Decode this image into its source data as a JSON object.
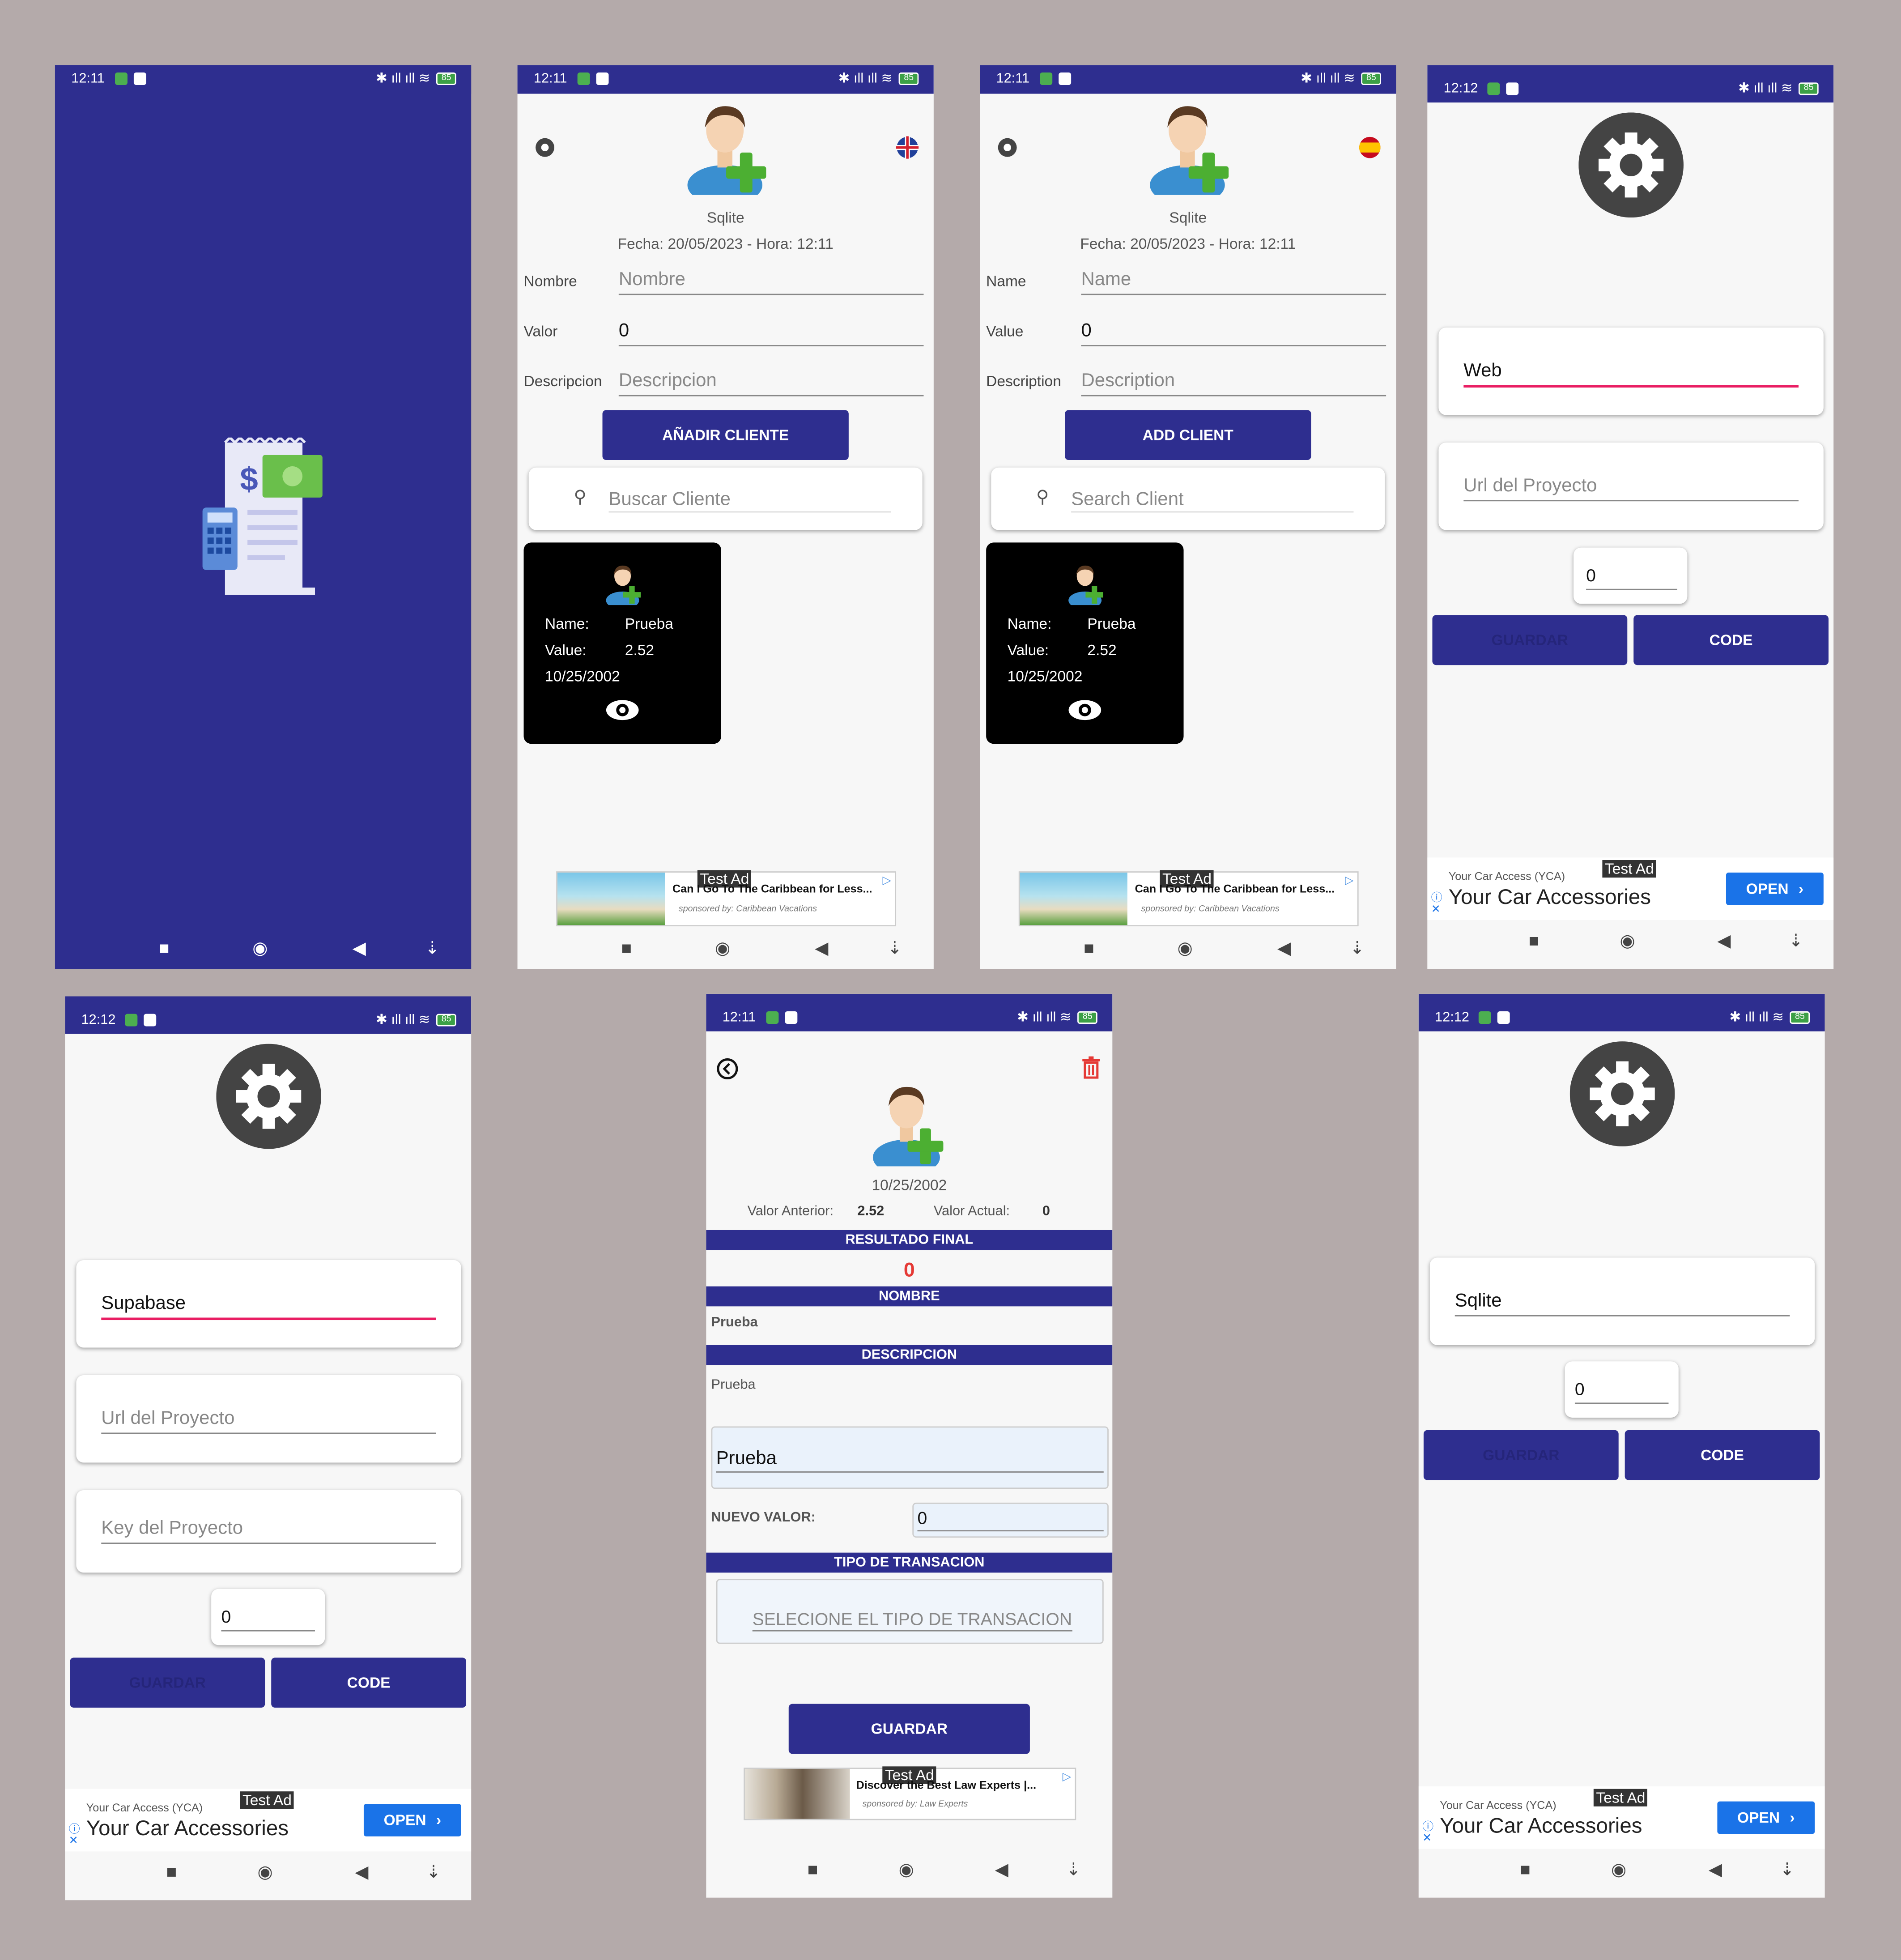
{
  "status": {
    "time_a": "12:11",
    "time_b": "12:12",
    "battery": "85"
  },
  "main_es": {
    "db": "Sqlite",
    "date": "Fecha: 20/05/2023 - Hora: 12:11",
    "name_label": "Nombre",
    "name_ph": "Nombre",
    "value_label": "Valor",
    "value": "0",
    "desc_label": "Descripcion",
    "desc_ph": "Descripcion",
    "add_button": "AÑADIR CLIENTE",
    "search_ph": "Buscar Cliente"
  },
  "main_en": {
    "db": "Sqlite",
    "date": "Fecha: 20/05/2023 - Hora: 12:11",
    "name_label": "Name",
    "name_ph": "Name",
    "value_label": "Value",
    "value": "0",
    "desc_label": "Description",
    "desc_ph": "Description",
    "add_button": "ADD CLIENT",
    "search_ph": "Search Client"
  },
  "client_card": {
    "name_label": "Name:",
    "name": "Prueba",
    "value_label": "Value:",
    "value": "2.52",
    "date": "10/25/2002"
  },
  "ad_small_1": {
    "test": "Test Ad",
    "headline": "Can I Go To The Caribbean for Less...",
    "sponsor": "sponsored by: Caribbean Vacations"
  },
  "ad_small_2": {
    "test": "Test Ad",
    "headline": "Discover the Best Law Experts |...",
    "sponsor": "sponsored by: Law Experts"
  },
  "ad_banner": {
    "test": "Test Ad",
    "advertiser": "Your Car Access (YCA)",
    "title": "Your Car Accessories",
    "open": "OPEN"
  },
  "settings_web": {
    "mode": "Web",
    "url_ph": "Url del Proyecto",
    "code_value": "0",
    "save": "GUARDAR",
    "code": "CODE"
  },
  "settings_supabase": {
    "mode": "Supabase",
    "url_ph": "Url del Proyecto",
    "key_ph": "Key del Proyecto",
    "code_value": "0",
    "save": "GUARDAR",
    "code": "CODE"
  },
  "settings_sqlite": {
    "mode": "Sqlite",
    "code_value": "0",
    "save": "GUARDAR",
    "code": "CODE"
  },
  "detail": {
    "date": "10/25/2002",
    "prev_label": "Valor Anterior:",
    "prev": "2.52",
    "curr_label": "Valor Actual:",
    "curr": "0",
    "result_title": "RESULTADO FINAL",
    "result": "0",
    "name_title": "NOMBRE",
    "name": "Prueba",
    "desc_title": "DESCRIPCION",
    "desc": "Prueba",
    "desc_input": "Prueba",
    "new_value_label": "NUEVO VALOR:",
    "new_value": "0",
    "type_title": "TIPO DE TRANSACION",
    "type_ph": "SELECIONE EL TIPO DE TRANSACION",
    "save": "GUARDAR"
  },
  "colors": {
    "primary": "#2e2e8f",
    "accent": "#e91e63",
    "danger": "#e53935",
    "ad_blue": "#1a73e8"
  }
}
